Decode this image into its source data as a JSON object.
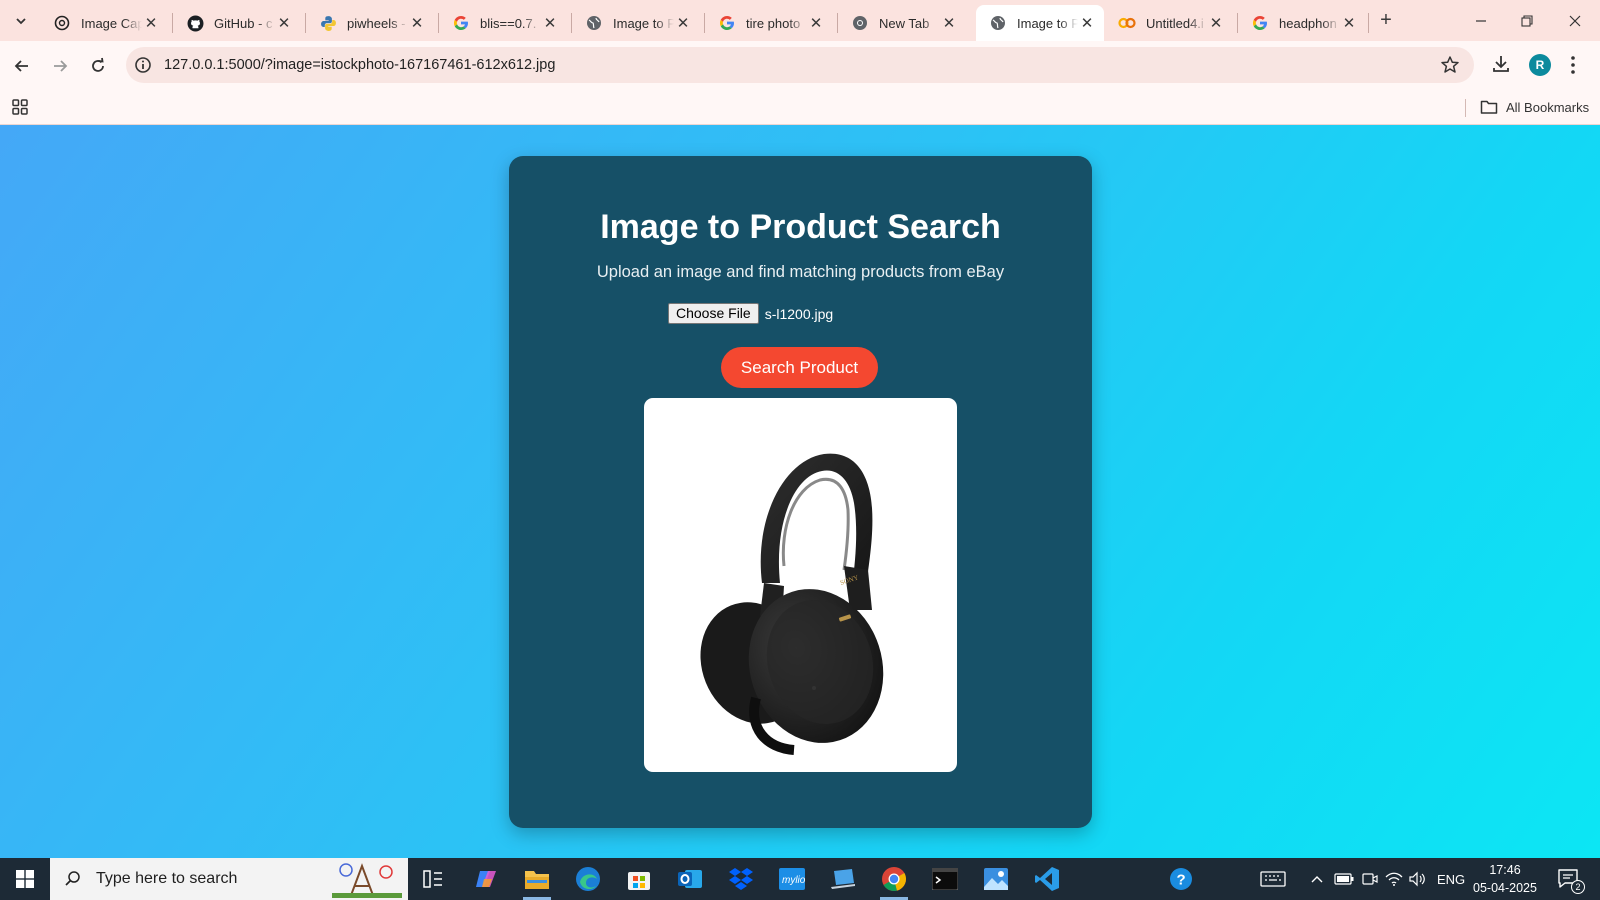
{
  "browser": {
    "tabs": [
      {
        "title": "Image Cap",
        "icon": "openai-icon",
        "active": false
      },
      {
        "title": "GitHub - c",
        "icon": "github-icon",
        "active": false
      },
      {
        "title": "piwheels -",
        "icon": "python-icon",
        "active": false
      },
      {
        "title": "blis==0.7.",
        "icon": "google-icon",
        "active": false
      },
      {
        "title": "Image to P",
        "icon": "globe-icon",
        "active": false
      },
      {
        "title": "tire photo",
        "icon": "google-icon",
        "active": false
      },
      {
        "title": "New Tab",
        "icon": "chrome-icon",
        "active": false
      },
      {
        "title": "Image to P",
        "icon": "globe-icon",
        "active": true
      },
      {
        "title": "Untitled4.i",
        "icon": "colab-icon",
        "active": false
      },
      {
        "title": "headphon",
        "icon": "google-icon",
        "active": false
      }
    ],
    "url": "127.0.0.1:5000/?image=istockphoto-167167461-612x612.jpg",
    "profile_initial": "R",
    "bookmarks_label": "All Bookmarks"
  },
  "page": {
    "title": "Image to Product Search",
    "subtitle": "Upload an image and find matching products from eBay",
    "choose_file_label": "Choose File",
    "file_name": "s-l1200.jpg",
    "search_button": "Search Product",
    "preview_brand": "SONY"
  },
  "taskbar": {
    "search_placeholder": "Type here to search",
    "language": "ENG",
    "time": "17:46",
    "date": "05-04-2025",
    "notification_count": "2"
  },
  "colors": {
    "card_bg": "#165067",
    "button_accent": "#f44830",
    "page_gradient_start": "#44a8f7",
    "page_gradient_end": "#0ce6f4"
  }
}
